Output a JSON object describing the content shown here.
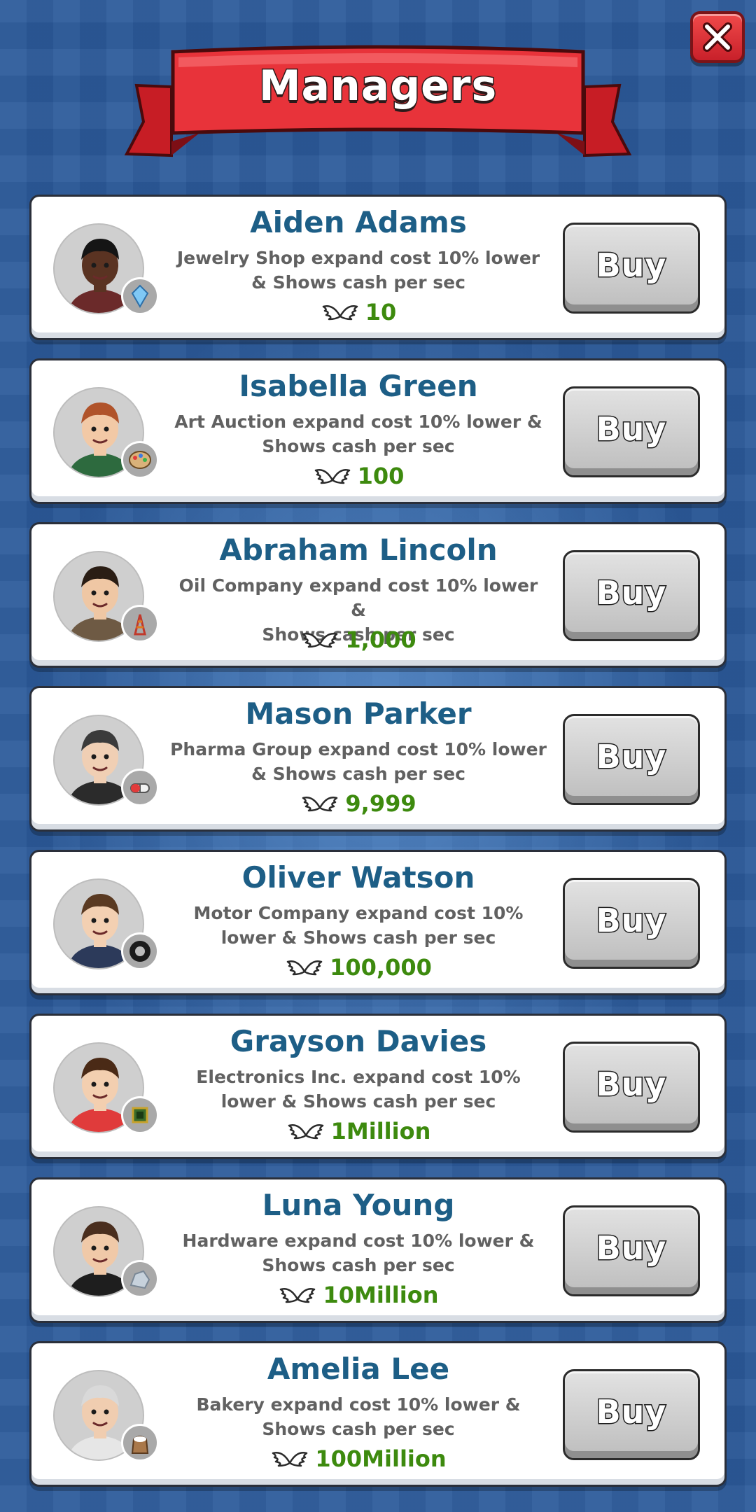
{
  "header": {
    "title": "Managers"
  },
  "close_icon": "close-x-icon",
  "currency_icon": "wings-icon",
  "colors": {
    "name": "#1d5e86",
    "price": "#3d8a0e",
    "banner": "#e8333a",
    "background": "#2b5a9a"
  },
  "managers": [
    {
      "name": "Aiden Adams",
      "desc1": "Jewelry Shop expand cost 10% lower",
      "desc2": "& Shows cash per sec",
      "price": "10",
      "buy": "Buy",
      "badge_icon": "diamond-icon",
      "shirt": "#6b2a2a",
      "hair": "#151515",
      "skin": "#5a3322"
    },
    {
      "name": "Isabella Green",
      "desc1": "Art Auction expand cost 10% lower &",
      "desc2": "Shows cash per sec",
      "price": "100",
      "buy": "Buy",
      "badge_icon": "palette-icon",
      "shirt": "#2d6a3e",
      "hair": "#b0532a",
      "skin": "#f2c9a6"
    },
    {
      "name": "Abraham Lincoln",
      "desc1": "Oil Company expand cost 10% lower &",
      "desc2": "Shows cash per sec",
      "price": "1,000",
      "buy": "Buy",
      "badge_icon": "oil-rig-icon",
      "shirt": "#6e5a44",
      "hair": "#2a1d14",
      "skin": "#efc7a4"
    },
    {
      "name": "Mason Parker",
      "desc1": "Pharma Group expand cost 10% lower",
      "desc2": "& Shows cash per sec",
      "price": "9,999",
      "buy": "Buy",
      "badge_icon": "pill-icon",
      "shirt": "#2b2b2b",
      "hair": "#3b3b3b",
      "skin": "#f0cfb4"
    },
    {
      "name": "Oliver Watson",
      "desc1": "Motor Company expand cost 10%",
      "desc2": "lower & Shows cash per sec",
      "price": "100,000",
      "buy": "Buy",
      "badge_icon": "tire-icon",
      "shirt": "#2c3a5a",
      "hair": "#5a3a22",
      "skin": "#f3d0b2"
    },
    {
      "name": "Grayson Davies",
      "desc1": "Electronics Inc. expand cost 10%",
      "desc2": "lower & Shows cash per sec",
      "price": "1Million",
      "buy": "Buy",
      "badge_icon": "microchip-icon",
      "shirt": "#e03b3b",
      "hair": "#4a2a16",
      "skin": "#f3cfb0"
    },
    {
      "name": "Luna Young",
      "desc1": "Hardware expand cost 10% lower &",
      "desc2": "Shows cash per sec",
      "price": "10Million",
      "buy": "Buy",
      "badge_icon": "ore-icon",
      "shirt": "#1e1e1e",
      "hair": "#4a2e1e",
      "skin": "#f0c9a8"
    },
    {
      "name": "Amelia Lee",
      "desc1": "Bakery expand cost 10% lower &",
      "desc2": "Shows cash per sec",
      "price": "100Million",
      "buy": "Buy",
      "badge_icon": "flour-sack-icon",
      "shirt": "#e6e6e6",
      "hair": "#d9d9d9",
      "skin": "#f0cdb0"
    }
  ]
}
